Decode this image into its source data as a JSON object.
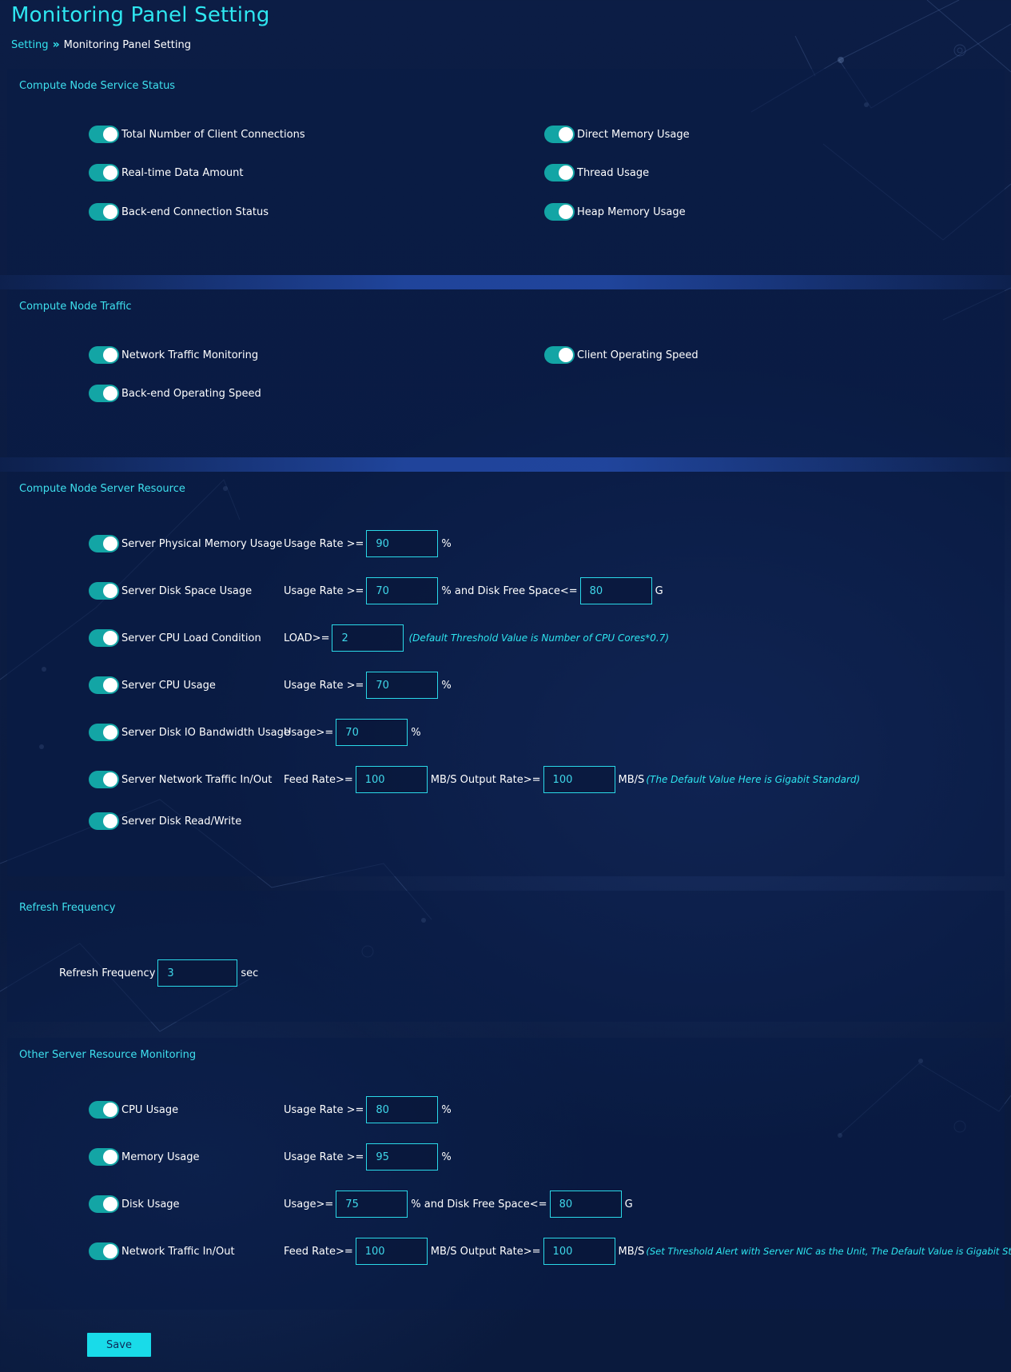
{
  "page_title": "Monitoring Panel Setting",
  "breadcrumb": {
    "link": "Setting",
    "separator": "»",
    "current": "Monitoring Panel Setting"
  },
  "service_status": {
    "title": "Compute Node Service Status",
    "left": [
      "Total Number of Client Connections",
      "Real-time Data Amount",
      "Back-end Connection Status"
    ],
    "right": [
      "Direct Memory Usage",
      "Thread Usage",
      "Heap Memory Usage"
    ]
  },
  "traffic": {
    "title": "Compute Node Traffic",
    "left": [
      "Network Traffic Monitoring",
      "Back-end Operating Speed"
    ],
    "right": [
      "Client Operating Speed"
    ]
  },
  "server_resource": {
    "title": "Compute Node Server Resource",
    "rows": [
      {
        "label": "Server Physical Memory Usage",
        "prefix": "Usage Rate >=",
        "value": "90",
        "suffix": "%"
      },
      {
        "label": "Server Disk Space Usage",
        "prefix": "Usage Rate >=",
        "value": "70",
        "mid": "% and Disk Free Space<=",
        "value2": "80",
        "suffix": "G"
      },
      {
        "label": "Server CPU Load Condition",
        "prefix": "LOAD>=",
        "value": "2",
        "hint": "(Default Threshold Value is Number of CPU Cores*0.7)"
      },
      {
        "label": "Server CPU Usage",
        "prefix": "Usage Rate >=",
        "value": "70",
        "suffix": "%"
      },
      {
        "label": "Server Disk IO Bandwidth Usage",
        "prefix": "Usage>=",
        "value": "70",
        "suffix": "%"
      },
      {
        "label": "Server Network Traffic In/Out",
        "prefix": "Feed Rate>=",
        "value": "100",
        "mid": "MB/S Output Rate>=",
        "value2": "100",
        "suffix": "MB/S",
        "hint": "(The Default Value Here is Gigabit Standard)"
      },
      {
        "label": "Server Disk Read/Write"
      }
    ]
  },
  "refresh": {
    "title": "Refresh Frequency",
    "label": "Refresh Frequency",
    "value": "3",
    "unit": "sec"
  },
  "other_resource": {
    "title": "Other Server Resource Monitoring",
    "rows": [
      {
        "label": "CPU Usage",
        "prefix": "Usage Rate >=",
        "value": "80",
        "suffix": "%"
      },
      {
        "label": "Memory Usage",
        "prefix": "Usage Rate >=",
        "value": "95",
        "suffix": "%"
      },
      {
        "label": "Disk Usage",
        "prefix": "Usage>=",
        "value": "75",
        "mid": "% and Disk Free Space<=",
        "value2": "80",
        "suffix": "G"
      },
      {
        "label": "Network Traffic In/Out",
        "prefix": "Feed Rate>=",
        "value": "100",
        "mid": "MB/S Output Rate>=",
        "value2": "100",
        "suffix": "MB/S",
        "hint": "(Set Threshold Alert with Server NIC as the Unit, The Default Value is Gigabit Standard)"
      }
    ]
  },
  "save_label": "Save",
  "colors": {
    "accent": "#2ee6f0",
    "toggle_on": "#13a5a5",
    "background": "#0b1c42",
    "save_button": "#19dbe9"
  }
}
